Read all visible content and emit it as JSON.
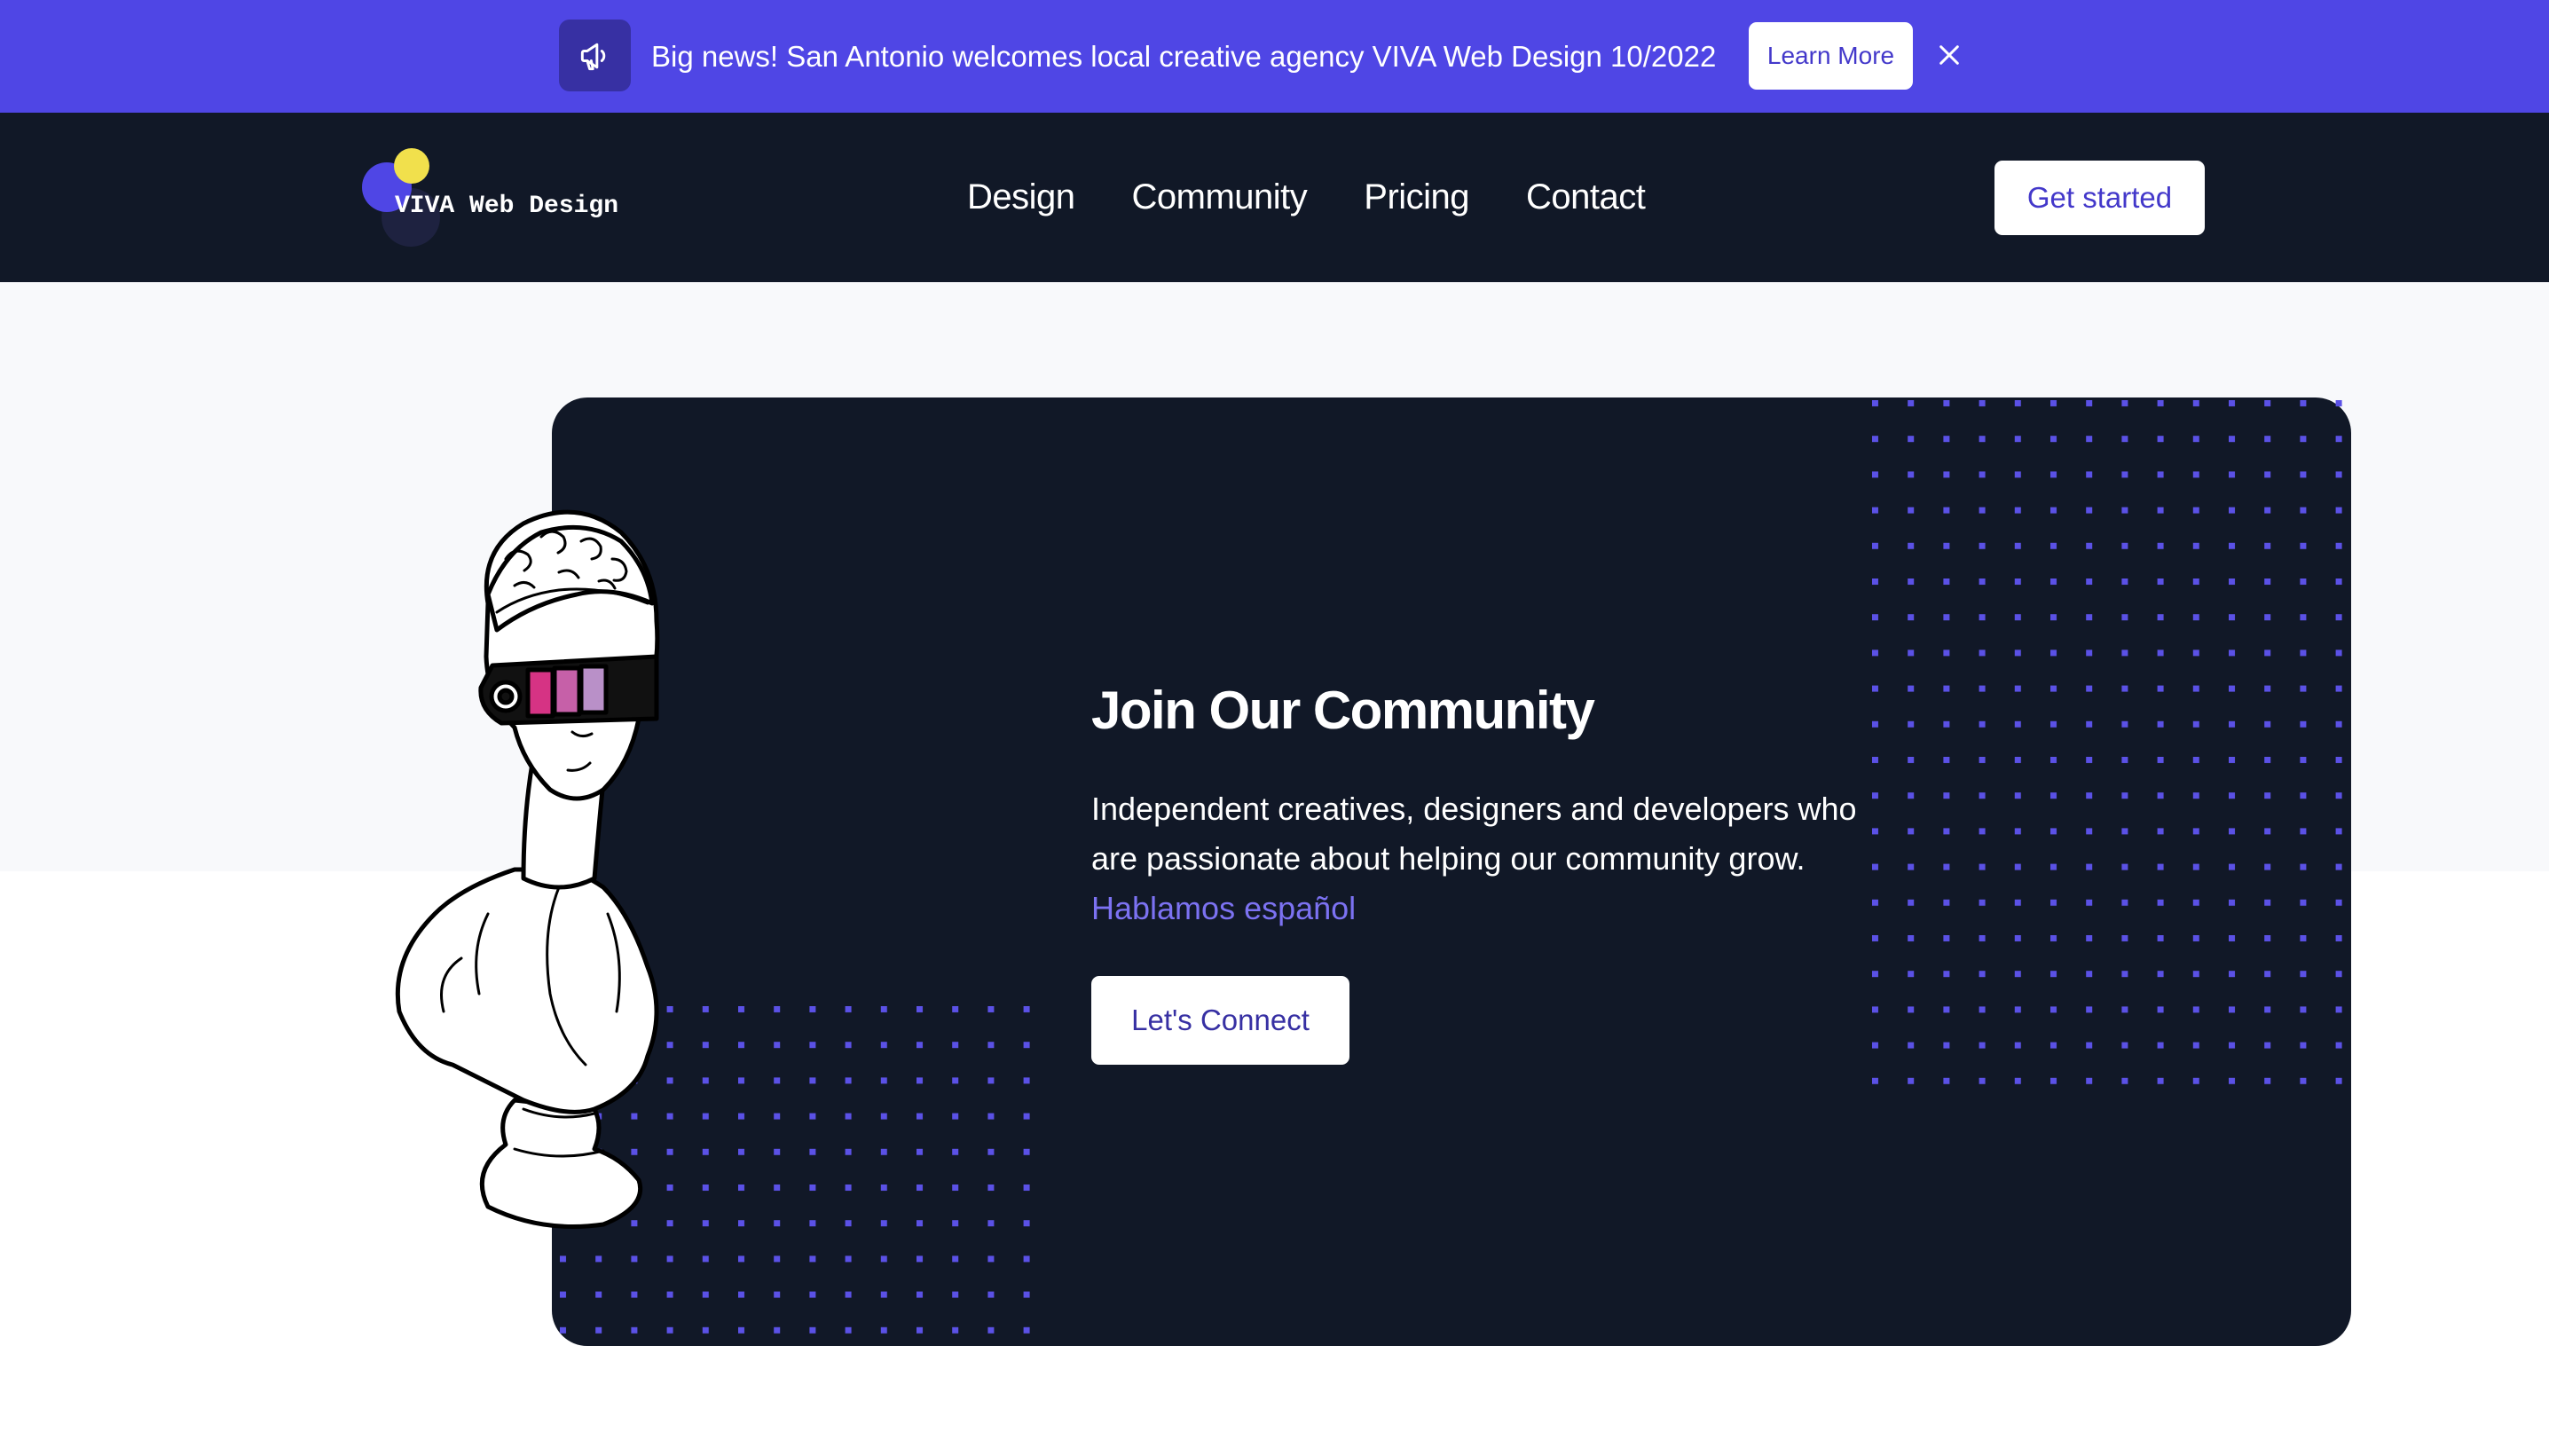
{
  "banner": {
    "icon": "megaphone-icon",
    "text": "Big news! San Antonio welcomes local creative agency VIVA Web Design 10/2022",
    "button_label": "Learn More",
    "close_icon": "close-icon",
    "background": "#4f46e5"
  },
  "header": {
    "logo_text": "VIVA Web Design",
    "nav": [
      "Design",
      "Community",
      "Pricing",
      "Contact"
    ],
    "cta_label": "Get started",
    "background": "#111827"
  },
  "hero": {
    "title": "Join Our Community",
    "description": "Independent creatives, designers and developers who are passionate about helping our community grow.",
    "link_text": "Hablamos español",
    "button_label": "Let's Connect",
    "accent": "#7c72f2",
    "illustration": "statue-bust-with-visor-illustration"
  }
}
